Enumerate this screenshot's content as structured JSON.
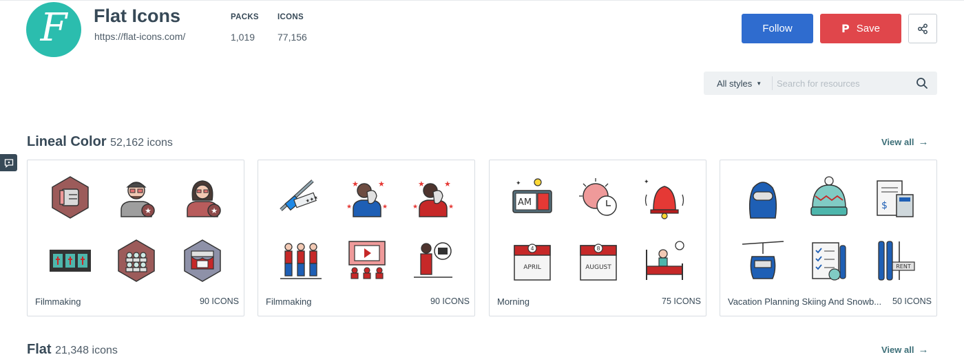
{
  "brand": {
    "logo_letter": "F",
    "name": "Flat Icons",
    "url": "https://flat-icons.com/"
  },
  "stats": {
    "packs_label": "PACKS",
    "packs_value": "1,019",
    "icons_label": "ICONS",
    "icons_value": "77,156"
  },
  "actions": {
    "follow_label": "Follow",
    "save_label": "Save",
    "save_icon": "pinterest-icon",
    "share_icon": "share-icon"
  },
  "search": {
    "style_label": "All styles",
    "placeholder": "Search for resources",
    "value": ""
  },
  "sections": [
    {
      "title": "Lineal Color",
      "count": "52,162 icons",
      "view_all": "View all",
      "cards": [
        {
          "title": "Filmmaking",
          "count": "90 ICONS",
          "icons": [
            "hand-icon",
            "director-icon",
            "actress-icon",
            "film-strip-icon",
            "cinema-audience-icon",
            "theater-stage-icon"
          ]
        },
        {
          "title": "Filmmaking",
          "count": "90 ICONS",
          "icons": [
            "camera-crane-icon",
            "comedy-mask-actor-icon",
            "tragedy-mask-actor-icon",
            "actors-queue-icon",
            "movie-screen-audience-icon",
            "reporter-icon"
          ]
        },
        {
          "title": "Morning",
          "count": "75 ICONS",
          "icons": [
            "alarm-clock-am-icon",
            "sunrise-clock-icon",
            "bell-icon",
            "calendar-april-icon",
            "calendar-august-icon",
            "wake-up-bed-icon"
          ]
        },
        {
          "title": "Vacation Planning Skiing And Snowb...",
          "count": "50 ICONS",
          "icons": [
            "ski-mask-icon",
            "beanie-icon",
            "bill-calculator-icon",
            "cable-car-icon",
            "checklist-icon",
            "ski-rental-icon"
          ]
        }
      ]
    },
    {
      "title": "Flat",
      "count": "21,348 icons",
      "view_all": "View all"
    }
  ],
  "colors": {
    "logo_teal": "#2bbdae",
    "follow_blue": "#2f6ccf",
    "save_red": "#e0464b",
    "view_all_teal": "#3c6e77",
    "text_dark": "#374957"
  }
}
